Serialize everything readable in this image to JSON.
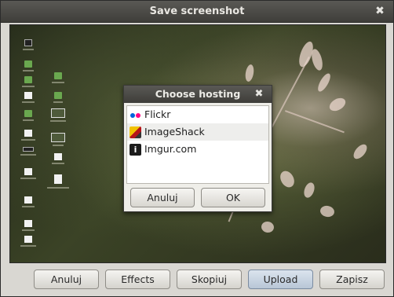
{
  "window": {
    "title": "Save screenshot"
  },
  "dialog": {
    "title": "Choose hosting",
    "items": [
      {
        "label": "Flickr",
        "icon": "flickr-icon"
      },
      {
        "label": "ImageShack",
        "icon": "imageshack-icon"
      },
      {
        "label": "Imgur.com",
        "icon": "imgur-icon"
      }
    ],
    "cancel_label": "Anuluj",
    "ok_label": "OK"
  },
  "buttons": {
    "cancel": "Anuluj",
    "effects": "Effects",
    "copy": "Skopiuj",
    "upload": "Upload",
    "save": "Zapisz"
  },
  "icons": {
    "close": "close-icon"
  },
  "colors": {
    "titlebar": "#4a4945",
    "window_bg": "#d9d7d2",
    "flickr_blue": "#0063dc",
    "flickr_pink": "#ff0084"
  }
}
